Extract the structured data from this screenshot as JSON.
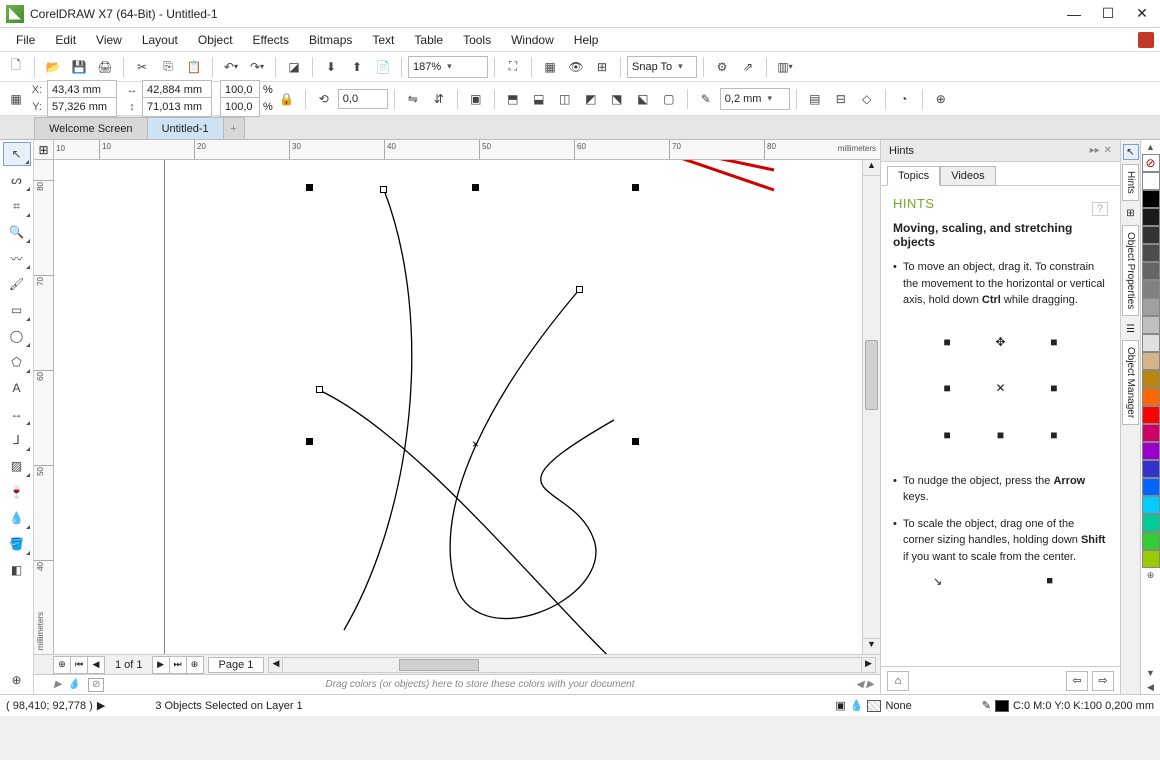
{
  "titlebar": {
    "title": "CorelDRAW X7 (64-Bit) - Untitled-1"
  },
  "menus": [
    "File",
    "Edit",
    "View",
    "Layout",
    "Object",
    "Effects",
    "Bitmaps",
    "Text",
    "Table",
    "Tools",
    "Window",
    "Help"
  ],
  "toolbar1": {
    "zoom": "187%",
    "snap": "Snap To"
  },
  "propbar": {
    "x_label": "X:",
    "x": "43,43 mm",
    "y_label": "Y:",
    "y": "57,326 mm",
    "w": "42,884 mm",
    "h": "71,013 mm",
    "scale_x": "100,0",
    "scale_y": "100,0",
    "pct": "%",
    "rotate": "0,0",
    "outline": "0,2 mm"
  },
  "doctabs": {
    "welcome": "Welcome Screen",
    "doc": "Untitled-1"
  },
  "ruler_units": "millimeters",
  "hints": {
    "panel_title": "Hints",
    "tab_topics": "Topics",
    "tab_videos": "Videos",
    "heading": "HINTS",
    "subheading": "Moving, scaling, and stretching objects",
    "tip1_a": "To move an object, drag it. To constrain the movement to the horizontal or vertical axis, hold down ",
    "tip1_b": "Ctrl",
    "tip1_c": " while dragging.",
    "tip2_a": "To nudge the object, press the ",
    "tip2_b": "Arrow",
    "tip2_c": " keys.",
    "tip3_a": "To scale the object, drag one of the corner sizing handles, holding down ",
    "tip3_b": "Shift",
    "tip3_c": " if you want to scale from the center."
  },
  "vdocker_tabs": [
    "Hints",
    "Object Properties",
    "Object Manager"
  ],
  "pagebar": {
    "info": "1 of 1",
    "page": "Page 1"
  },
  "colorbar_hint": "Drag colors (or objects) here to store these colors with your document",
  "status": {
    "coords": "( 98,410; 92,778 )",
    "selection": "3 Objects Selected on Layer 1",
    "fill": "None",
    "outline": "C:0 M:0 Y:0 K:100  0,200 mm"
  },
  "palette": [
    "#ffffff",
    "#000000",
    "#1b1b1b",
    "#333333",
    "#4d4d4d",
    "#666666",
    "#808080",
    "#a0a0a0",
    "#c0c0c0",
    "#e0e0e0",
    "#d4b58a",
    "#b8860b",
    "#ff6600",
    "#ff0000",
    "#cc0066",
    "#9900cc",
    "#3333cc",
    "#0066ff",
    "#00ccff",
    "#00cc99",
    "#33cc33",
    "#99cc00"
  ],
  "ruler_marks": [
    10,
    20,
    30,
    40,
    50,
    60,
    70,
    80
  ],
  "ruler_v_marks": [
    80,
    70,
    60,
    50,
    40
  ],
  "sel_origin_mark": 10
}
